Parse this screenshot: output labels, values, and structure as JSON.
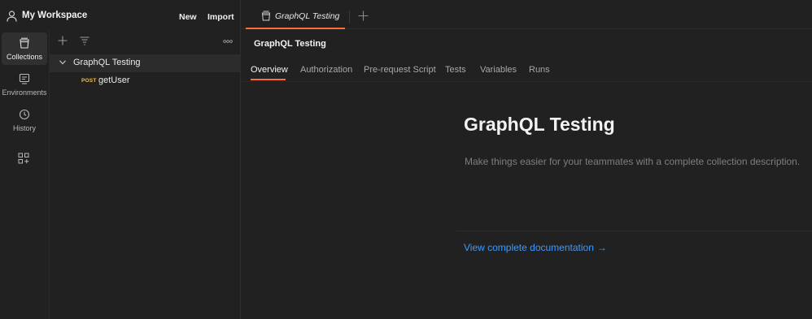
{
  "workspace": {
    "title": "My Workspace",
    "new_label": "New",
    "import_label": "Import"
  },
  "rail": {
    "items": [
      {
        "label": "Collections",
        "icon": "collections-icon",
        "active": true
      },
      {
        "label": "Environments",
        "icon": "environments-icon"
      },
      {
        "label": "History",
        "icon": "history-icon"
      }
    ],
    "apps_icon": "add-apps-icon"
  },
  "tree": {
    "collection": "GraphQL Testing",
    "requests": [
      {
        "method": "POST",
        "name": "getUser"
      }
    ]
  },
  "tabs": {
    "open": [
      {
        "label": "GraphQL Testing",
        "icon": "collection-icon"
      }
    ]
  },
  "collection": {
    "header": "GraphQL Testing",
    "subtabs": [
      "Overview",
      "Authorization",
      "Pre-request Script",
      "Tests",
      "Variables",
      "Runs"
    ],
    "active_subtab": "Overview",
    "title": "GraphQL Testing",
    "description_placeholder": "Make things easier for your teammates with a complete collection description.",
    "doc_link": "View complete documentation",
    "doc_arrow": "→"
  },
  "colors": {
    "accent": "#ff6c37",
    "method_post": "#f0c04a",
    "link": "#3d9bff",
    "background": "#212121"
  }
}
